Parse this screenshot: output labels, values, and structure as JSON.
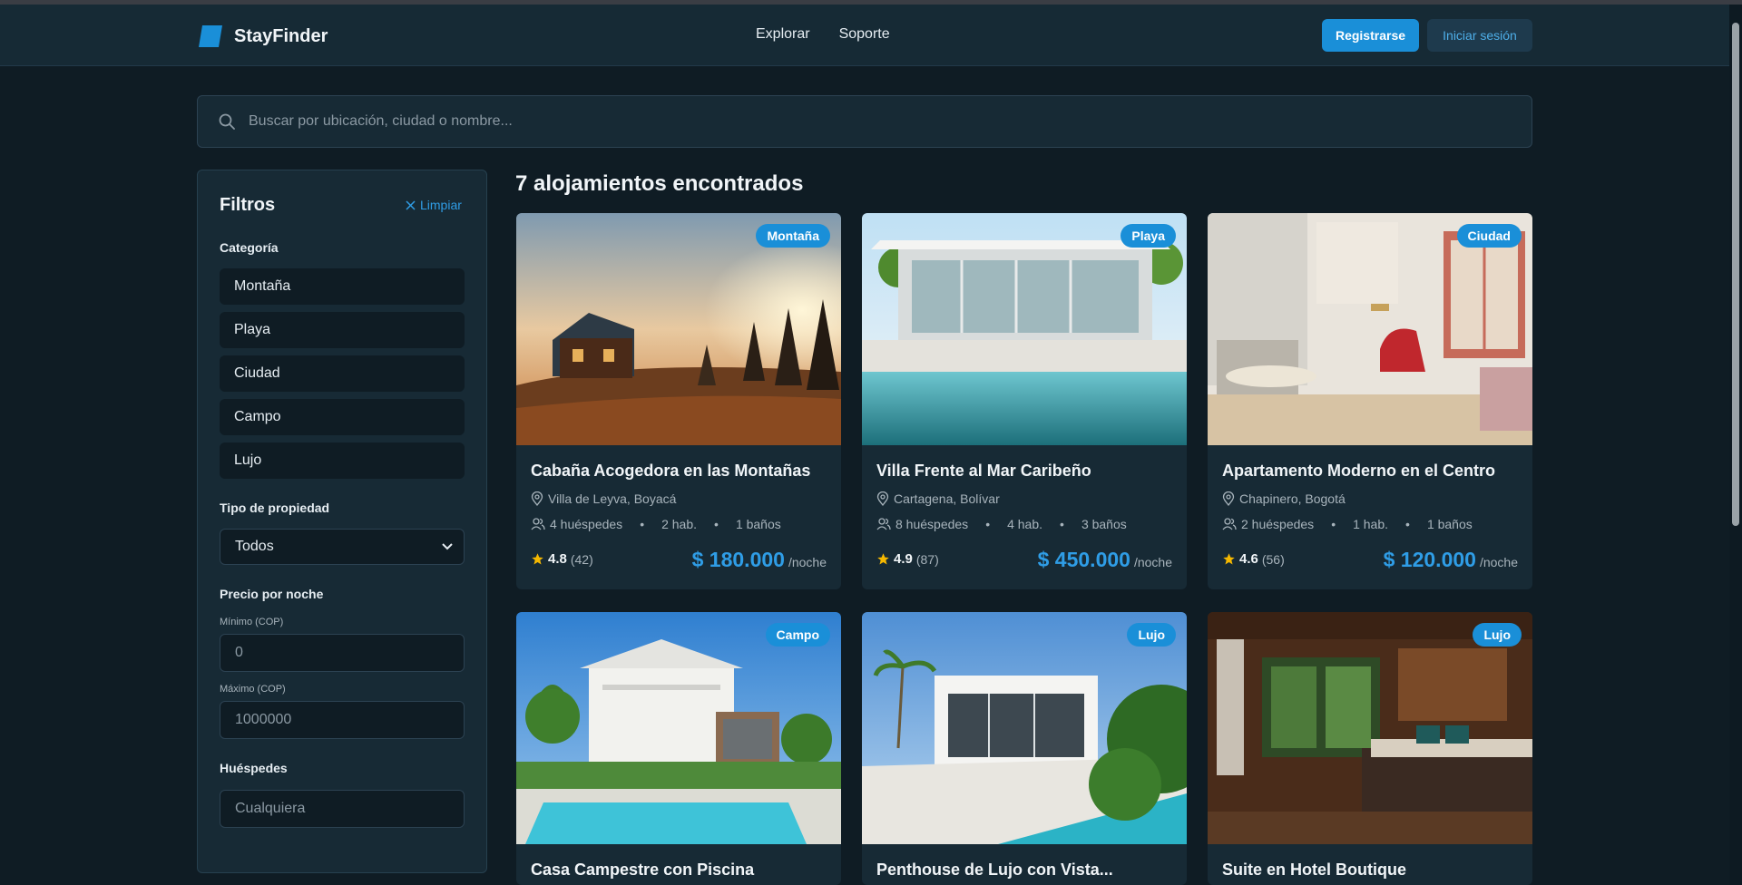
{
  "header": {
    "brand": "StayFinder",
    "nav": [
      "Explorar",
      "Soporte"
    ],
    "register_label": "Registrarse",
    "login_label": "Iniciar sesión"
  },
  "search": {
    "placeholder": "Buscar por ubicación, ciudad o nombre..."
  },
  "filters": {
    "title": "Filtros",
    "clear_label": "Limpiar",
    "category_label": "Categoría",
    "categories": [
      "Montaña",
      "Playa",
      "Ciudad",
      "Campo",
      "Lujo"
    ],
    "property_type_label": "Tipo de propiedad",
    "property_type_value": "Todos",
    "price_label": "Precio por noche",
    "min_label": "Mínimo (COP)",
    "min_placeholder": "0",
    "max_label": "Máximo (COP)",
    "max_placeholder": "1000000",
    "guests_label": "Huéspedes",
    "guests_placeholder": "Cualquiera"
  },
  "results": {
    "title": "7 alojamientos encontrados",
    "per_night": "/noche",
    "listings": [
      {
        "badge": "Montaña",
        "title": "Cabaña Acogedora en las Montañas",
        "location": "Villa de Leyva, Boyacá",
        "guests": "4 huéspedes",
        "rooms": "2 hab.",
        "baths": "1 baños",
        "rating": "4.8",
        "reviews": "(42)",
        "price": "$ 180.000"
      },
      {
        "badge": "Playa",
        "title": "Villa Frente al Mar Caribeño",
        "location": "Cartagena, Bolívar",
        "guests": "8 huéspedes",
        "rooms": "4 hab.",
        "baths": "3 baños",
        "rating": "4.9",
        "reviews": "(87)",
        "price": "$ 450.000"
      },
      {
        "badge": "Ciudad",
        "title": "Apartamento Moderno en el Centro",
        "location": "Chapinero, Bogotá",
        "guests": "2 huéspedes",
        "rooms": "1 hab.",
        "baths": "1 baños",
        "rating": "4.6",
        "reviews": "(56)",
        "price": "$ 120.000"
      },
      {
        "badge": "Campo",
        "title": "Casa Campestre con Piscina"
      },
      {
        "badge": "Lujo",
        "title": "Penthouse de Lujo con Vista..."
      },
      {
        "badge": "Lujo",
        "title": "Suite en Hotel Boutique"
      }
    ]
  },
  "colors": {
    "background": "#0f1c24",
    "panel": "#172a35",
    "accent": "#1a8fd8",
    "star": "#f5b800"
  }
}
